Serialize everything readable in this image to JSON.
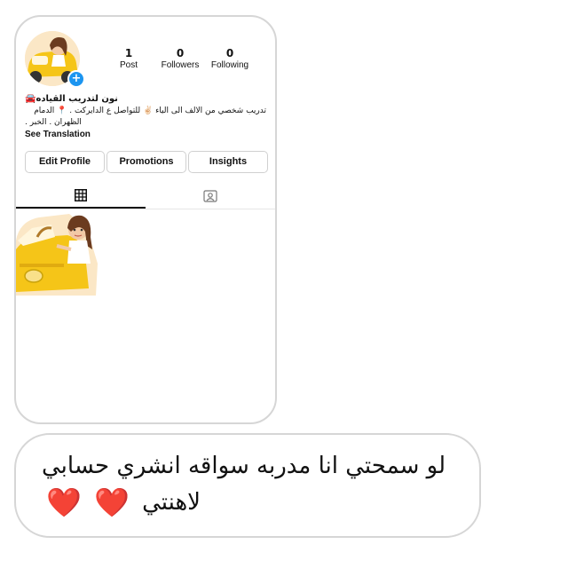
{
  "profile": {
    "add_badge": "+",
    "stats": [
      {
        "value": "1",
        "label": "Post"
      },
      {
        "value": "0",
        "label": "Followers"
      },
      {
        "value": "0",
        "label": "Following"
      }
    ],
    "name": "نون لتدريب القياده🚘",
    "bio_line_1": "تدريب شخصي من الالف الى الياء ✌🏻 للتواصل ع الدايركت . 📍 الدمام",
    "bio_line_2": ". الظهران . الخبر",
    "see_translation": "See Translation",
    "buttons": {
      "edit": "Edit Profile",
      "promotions": "Promotions",
      "insights": "Insights"
    },
    "tabs": [
      "grid-icon",
      "tagged-icon"
    ],
    "posts_count": 1
  },
  "message": {
    "line_1": "لو سمحتي انا مدربه سواقه انشري حسابي",
    "line_2": "لاهنتي",
    "hearts": [
      "❤️",
      "❤️"
    ]
  },
  "colors": {
    "accent_blue": "#1c95f0",
    "heart_red": "#e01e2e",
    "car_yellow": "#f5c518",
    "border_gray": "#d6d6d6"
  }
}
